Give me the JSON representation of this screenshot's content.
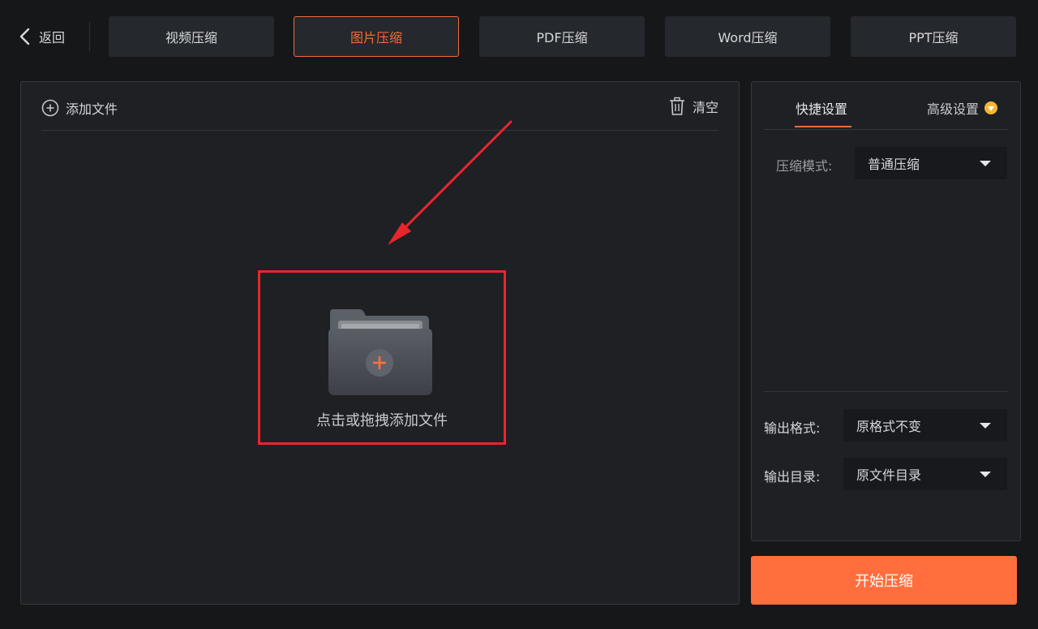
{
  "topbar": {
    "back_label": "返回",
    "tabs": [
      {
        "label": "视频压缩",
        "active": false
      },
      {
        "label": "图片压缩",
        "active": true
      },
      {
        "label": "PDF压缩",
        "active": false
      },
      {
        "label": "Word压缩",
        "active": false
      },
      {
        "label": "PPT压缩",
        "active": false
      }
    ]
  },
  "file_panel": {
    "add_file_label": "添加文件",
    "clear_label": "清空",
    "drop_zone_text": "点击或拖拽添加文件"
  },
  "settings": {
    "tabs": {
      "quick": "快捷设置",
      "advanced": "高级设置"
    },
    "compression_mode": {
      "label": "压缩模式:",
      "value": "普通压缩"
    },
    "output_format": {
      "label": "输出格式:",
      "value": "原格式不变"
    },
    "output_dir": {
      "label": "输出目录:",
      "value": "原文件目录"
    }
  },
  "start_button_label": "开始压缩",
  "colors": {
    "accent": "#ff6e3c",
    "highlight_border": "#e8262b",
    "background": "#151719",
    "panel": "#1e2023"
  },
  "icons": [
    "chevron-left-icon",
    "plus-circle-icon",
    "trash-icon",
    "folder-add-icon",
    "vip-badge-icon",
    "caret-down-icon"
  ]
}
